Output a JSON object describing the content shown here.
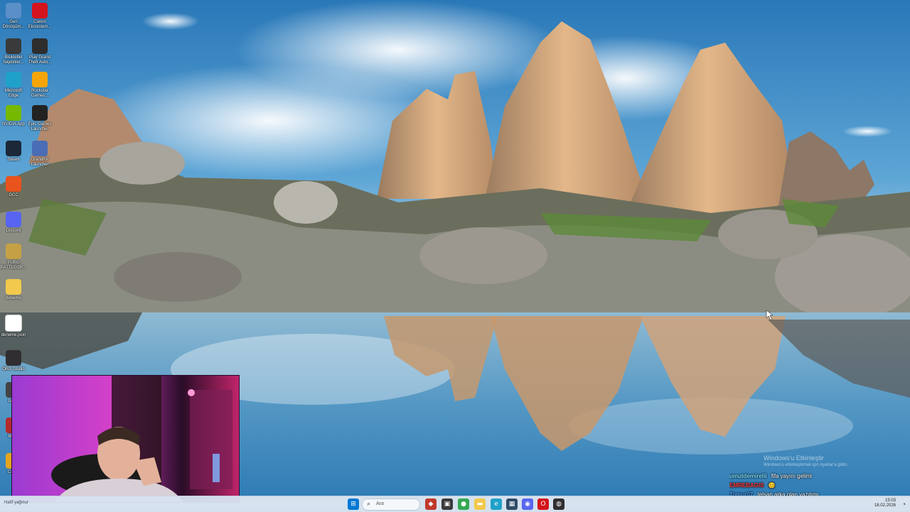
{
  "desktop": {
    "icons": [
      {
        "label": "Geri Dönüşüm...",
        "icon": "recycle-bin-icon",
        "color": "#5a8fc8"
      },
      {
        "label": "Canon Ekosistem...",
        "icon": "canon-icon",
        "color": "#d4141c"
      },
      {
        "label": "Bisikletlet haydinler...",
        "icon": "app-icon",
        "color": "#3a3a3a"
      },
      {
        "label": "Play Grand Theft Auto...",
        "icon": "gta-icon",
        "color": "#2d2d2d"
      },
      {
        "label": "Microsoft Edge",
        "icon": "edge-icon",
        "color": "#1fa1c9"
      },
      {
        "label": "Rockstar Games...",
        "icon": "rockstar-icon",
        "color": "#f5a50a"
      },
      {
        "label": "NVIDIA App",
        "icon": "nvidia-icon",
        "color": "#76b900"
      },
      {
        "label": "Epic Games Launcher",
        "icon": "epic-games-icon",
        "color": "#222222"
      },
      {
        "label": "Steam",
        "icon": "steam-icon",
        "color": "#1b2838"
      },
      {
        "label": "GrandRP Launcher",
        "icon": "grandrp-icon",
        "color": "#4a6db5"
      },
      {
        "label": "GCC",
        "icon": "gcc-icon",
        "color": "#e8531e"
      },
      {
        "label": "Discord",
        "icon": "discord-icon",
        "color": "#5865f2"
      },
      {
        "label": "PUBG BATTLEGR...",
        "icon": "pubg-icon",
        "color": "#c5a045"
      },
      {
        "label": "deneme",
        "icon": "folder-icon",
        "color": "#f2c94c"
      },
      {
        "label": "deneme.json",
        "icon": "file-icon",
        "color": "#ffffff"
      },
      {
        "label": "OBS Studio",
        "icon": "obs-icon",
        "color": "#302e31"
      },
      {
        "label": "Leg...",
        "icon": "app-icon",
        "color": "#444444"
      },
      {
        "label": "Mai...",
        "icon": "app-icon",
        "color": "#b52a2a"
      },
      {
        "label": "Cou...",
        "icon": "app-icon",
        "color": "#e3a521"
      }
    ]
  },
  "watermark": {
    "line1": "Windows'u Etkinleştir",
    "line2": "Windows'u etkinleştirmek için Ayarlar'a gidin."
  },
  "chat": [
    {
      "user": "umutdemirelli",
      "user_color": "#7fe0ff",
      "message": "fifa yayını gelimi"
    },
    {
      "user": "EMREBAGIS",
      "user_color": "#ff3b3b",
      "message": "😊"
    },
    {
      "user": "Tomur07",
      "user_color": "#4fa3ff",
      "message": "telsan arka plan yazılımı"
    }
  ],
  "taskbar": {
    "status_text": "Hafif yağmur",
    "search_placeholder": "Ara",
    "pinned": [
      {
        "icon": "start-icon",
        "glyph": "⊞",
        "color": "#0078d4"
      },
      {
        "icon": "game-icon",
        "glyph": "◆",
        "color": "#c0392b"
      },
      {
        "icon": "task-view-icon",
        "glyph": "▣",
        "color": "#3a3a3a"
      },
      {
        "icon": "chrome-icon",
        "glyph": "●",
        "color": "#34a853"
      },
      {
        "icon": "file-explorer-icon",
        "glyph": "▬",
        "color": "#f2c94c"
      },
      {
        "icon": "edge-icon",
        "glyph": "e",
        "color": "#1fa1c9"
      },
      {
        "icon": "store-icon",
        "glyph": "▦",
        "color": "#2f4b68"
      },
      {
        "icon": "discord-icon",
        "glyph": "◉",
        "color": "#5865f2"
      },
      {
        "icon": "opera-icon",
        "glyph": "O",
        "color": "#d4141c"
      },
      {
        "icon": "obs-icon",
        "glyph": "◍",
        "color": "#302e31"
      }
    ],
    "clock_time": "15:03",
    "clock_date": "18.02.2026"
  }
}
